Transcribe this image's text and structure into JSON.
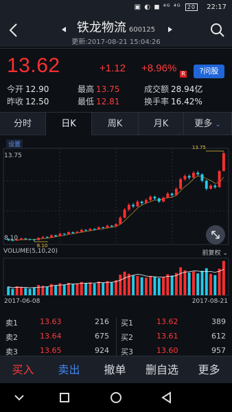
{
  "status_bar": {
    "time": "22:17",
    "icons": "▣ ◐ ◼ ⁴ᴳ ⁴ᴳ",
    "battery": "20"
  },
  "header": {
    "title": "铁龙物流",
    "code": "600125",
    "subtitle": "更新:2017-08-21 15:04:26"
  },
  "quote": {
    "price": "13.62",
    "change": "+1.12",
    "change_pct": "+8.96%",
    "badge": "R",
    "ask_label": "问股",
    "rows": [
      [
        {
          "k": "今开",
          "v": "12.90",
          "red": false
        },
        {
          "k": "最高",
          "v": "13.75",
          "red": true
        },
        {
          "k": "成交额",
          "v": "28.94亿",
          "red": false
        }
      ],
      [
        {
          "k": "昨收",
          "v": "12.50",
          "red": false
        },
        {
          "k": "最低",
          "v": "12.81",
          "red": true
        },
        {
          "k": "换手率",
          "v": "16.42%",
          "red": false
        }
      ]
    ]
  },
  "tabs": [
    {
      "label": "分时",
      "active": false
    },
    {
      "label": "日K",
      "active": true
    },
    {
      "label": "周K",
      "active": false
    },
    {
      "label": "月K",
      "active": false
    },
    {
      "label": "更多",
      "active": false,
      "dropdown": true
    }
  ],
  "chart": {
    "settings_label": "设置",
    "max_label": "13.75",
    "high_marker": "13.75",
    "min_label": "8.10",
    "left_bottom": "8.10",
    "volume_title": "VOLUME(5,10,20)",
    "adjust_label": "前复权",
    "date_start": "2017-06-08",
    "date_end": "2017-08-21",
    "colors": {
      "up": "#ff2f2f",
      "down": "#25c9e8",
      "ma": "#ffffff"
    }
  },
  "chart_data": {
    "type": "candlestick",
    "symbol": "600125",
    "date_range": [
      "2017-06-08",
      "2017-08-21"
    ],
    "ylim": [
      8.1,
      13.75
    ],
    "candles": [
      [
        8.25,
        8.2,
        8.32,
        8.15
      ],
      [
        8.2,
        8.18,
        8.26,
        8.12
      ],
      [
        8.18,
        8.22,
        8.28,
        8.14
      ],
      [
        8.22,
        8.3,
        8.36,
        8.2
      ],
      [
        8.3,
        8.26,
        8.34,
        8.22
      ],
      [
        8.26,
        8.24,
        8.3,
        8.18
      ],
      [
        8.24,
        8.2,
        8.28,
        8.1
      ],
      [
        8.2,
        8.34,
        8.38,
        8.18
      ],
      [
        8.34,
        8.4,
        8.46,
        8.3
      ],
      [
        8.4,
        8.36,
        8.44,
        8.32
      ],
      [
        8.36,
        8.5,
        8.56,
        8.34
      ],
      [
        8.5,
        8.44,
        8.54,
        8.4
      ],
      [
        8.44,
        8.6,
        8.66,
        8.42
      ],
      [
        8.6,
        8.56,
        8.64,
        8.5
      ],
      [
        8.56,
        8.7,
        8.76,
        8.54
      ],
      [
        8.7,
        8.64,
        8.74,
        8.6
      ],
      [
        8.64,
        8.72,
        8.78,
        8.6
      ],
      [
        8.72,
        8.84,
        8.9,
        8.7
      ],
      [
        8.84,
        8.8,
        8.88,
        8.74
      ],
      [
        8.8,
        8.9,
        8.96,
        8.78
      ],
      [
        8.9,
        8.86,
        8.94,
        8.8
      ],
      [
        8.86,
        9.0,
        9.06,
        8.84
      ],
      [
        9.0,
        8.96,
        9.04,
        8.9
      ],
      [
        8.96,
        9.1,
        9.16,
        8.92
      ],
      [
        9.1,
        9.04,
        9.14,
        8.98
      ],
      [
        9.04,
        9.2,
        9.26,
        9.02
      ],
      [
        9.2,
        9.6,
        9.7,
        9.18
      ],
      [
        9.6,
        10.1,
        10.2,
        9.56
      ],
      [
        10.1,
        10.4,
        10.5,
        10.0
      ],
      [
        10.4,
        10.3,
        10.52,
        10.2
      ],
      [
        10.3,
        10.6,
        10.7,
        10.26
      ],
      [
        10.6,
        10.5,
        10.66,
        10.4
      ],
      [
        10.5,
        10.7,
        10.8,
        10.46
      ],
      [
        10.7,
        10.9,
        11.0,
        10.62
      ],
      [
        10.9,
        10.8,
        10.98,
        10.7
      ],
      [
        10.8,
        10.6,
        10.86,
        10.52
      ],
      [
        10.6,
        10.84,
        10.92,
        10.56
      ],
      [
        10.84,
        11.1,
        11.2,
        10.8
      ],
      [
        11.1,
        11.0,
        11.16,
        10.9
      ],
      [
        11.0,
        11.4,
        11.5,
        10.96
      ],
      [
        11.4,
        12.0,
        12.1,
        11.36
      ],
      [
        12.0,
        12.2,
        12.3,
        11.9
      ],
      [
        12.2,
        12.1,
        12.3,
        11.98
      ],
      [
        12.1,
        12.4,
        12.5,
        12.04
      ],
      [
        12.4,
        12.3,
        12.52,
        12.2
      ],
      [
        12.3,
        11.9,
        12.36,
        11.8
      ],
      [
        11.9,
        11.4,
        11.96,
        11.3
      ],
      [
        11.4,
        11.6,
        11.7,
        11.34
      ],
      [
        11.6,
        11.5,
        11.68,
        11.4
      ],
      [
        11.5,
        12.5,
        12.56,
        11.46
      ],
      [
        12.5,
        13.62,
        13.75,
        12.81
      ]
    ],
    "volumes": [
      0.4,
      0.3,
      0.42,
      0.38,
      0.34,
      0.3,
      0.36,
      0.48,
      0.44,
      0.4,
      0.52,
      0.46,
      0.56,
      0.5,
      0.58,
      0.52,
      0.54,
      0.62,
      0.56,
      0.6,
      0.54,
      0.64,
      0.58,
      0.66,
      0.6,
      0.7,
      0.96,
      1.1,
      1.0,
      0.92,
      0.9,
      0.84,
      0.82,
      0.9,
      0.86,
      0.8,
      0.84,
      0.98,
      0.92,
      1.04,
      1.3,
      1.16,
      1.06,
      1.1,
      1.02,
      1.14,
      1.26,
      1.0,
      0.94,
      1.24,
      1.6
    ]
  },
  "order_book": {
    "asks": [
      {
        "label": "卖1",
        "price": "13.63",
        "vol": "216"
      },
      {
        "label": "卖2",
        "price": "13.64",
        "vol": "675"
      },
      {
        "label": "卖3",
        "price": "13.65",
        "vol": "924"
      }
    ],
    "bids": [
      {
        "label": "买1",
        "price": "13.62",
        "vol": "389"
      },
      {
        "label": "买2",
        "price": "13.61",
        "vol": "612"
      },
      {
        "label": "买3",
        "price": "13.60",
        "vol": "957"
      }
    ]
  },
  "actions": {
    "buy": "买入",
    "sell": "卖出",
    "cancel": "撤单",
    "remove": "删自选",
    "more": "更多"
  }
}
